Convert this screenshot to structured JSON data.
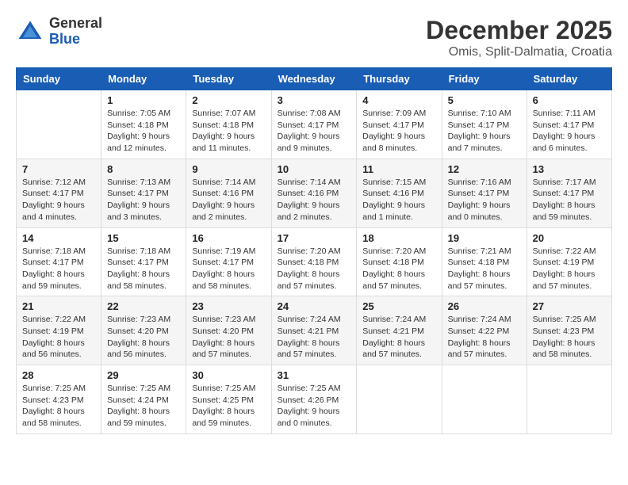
{
  "logo": {
    "general": "General",
    "blue": "Blue"
  },
  "header": {
    "month": "December 2025",
    "location": "Omis, Split-Dalmatia, Croatia"
  },
  "weekdays": [
    "Sunday",
    "Monday",
    "Tuesday",
    "Wednesday",
    "Thursday",
    "Friday",
    "Saturday"
  ],
  "weeks": [
    [
      {
        "day": "",
        "sunrise": "",
        "sunset": "",
        "daylight": ""
      },
      {
        "day": "1",
        "sunrise": "Sunrise: 7:05 AM",
        "sunset": "Sunset: 4:18 PM",
        "daylight": "Daylight: 9 hours and 12 minutes."
      },
      {
        "day": "2",
        "sunrise": "Sunrise: 7:07 AM",
        "sunset": "Sunset: 4:18 PM",
        "daylight": "Daylight: 9 hours and 11 minutes."
      },
      {
        "day": "3",
        "sunrise": "Sunrise: 7:08 AM",
        "sunset": "Sunset: 4:17 PM",
        "daylight": "Daylight: 9 hours and 9 minutes."
      },
      {
        "day": "4",
        "sunrise": "Sunrise: 7:09 AM",
        "sunset": "Sunset: 4:17 PM",
        "daylight": "Daylight: 9 hours and 8 minutes."
      },
      {
        "day": "5",
        "sunrise": "Sunrise: 7:10 AM",
        "sunset": "Sunset: 4:17 PM",
        "daylight": "Daylight: 9 hours and 7 minutes."
      },
      {
        "day": "6",
        "sunrise": "Sunrise: 7:11 AM",
        "sunset": "Sunset: 4:17 PM",
        "daylight": "Daylight: 9 hours and 6 minutes."
      }
    ],
    [
      {
        "day": "7",
        "sunrise": "Sunrise: 7:12 AM",
        "sunset": "Sunset: 4:17 PM",
        "daylight": "Daylight: 9 hours and 4 minutes."
      },
      {
        "day": "8",
        "sunrise": "Sunrise: 7:13 AM",
        "sunset": "Sunset: 4:17 PM",
        "daylight": "Daylight: 9 hours and 3 minutes."
      },
      {
        "day": "9",
        "sunrise": "Sunrise: 7:14 AM",
        "sunset": "Sunset: 4:16 PM",
        "daylight": "Daylight: 9 hours and 2 minutes."
      },
      {
        "day": "10",
        "sunrise": "Sunrise: 7:14 AM",
        "sunset": "Sunset: 4:16 PM",
        "daylight": "Daylight: 9 hours and 2 minutes."
      },
      {
        "day": "11",
        "sunrise": "Sunrise: 7:15 AM",
        "sunset": "Sunset: 4:16 PM",
        "daylight": "Daylight: 9 hours and 1 minute."
      },
      {
        "day": "12",
        "sunrise": "Sunrise: 7:16 AM",
        "sunset": "Sunset: 4:17 PM",
        "daylight": "Daylight: 9 hours and 0 minutes."
      },
      {
        "day": "13",
        "sunrise": "Sunrise: 7:17 AM",
        "sunset": "Sunset: 4:17 PM",
        "daylight": "Daylight: 8 hours and 59 minutes."
      }
    ],
    [
      {
        "day": "14",
        "sunrise": "Sunrise: 7:18 AM",
        "sunset": "Sunset: 4:17 PM",
        "daylight": "Daylight: 8 hours and 59 minutes."
      },
      {
        "day": "15",
        "sunrise": "Sunrise: 7:18 AM",
        "sunset": "Sunset: 4:17 PM",
        "daylight": "Daylight: 8 hours and 58 minutes."
      },
      {
        "day": "16",
        "sunrise": "Sunrise: 7:19 AM",
        "sunset": "Sunset: 4:17 PM",
        "daylight": "Daylight: 8 hours and 58 minutes."
      },
      {
        "day": "17",
        "sunrise": "Sunrise: 7:20 AM",
        "sunset": "Sunset: 4:18 PM",
        "daylight": "Daylight: 8 hours and 57 minutes."
      },
      {
        "day": "18",
        "sunrise": "Sunrise: 7:20 AM",
        "sunset": "Sunset: 4:18 PM",
        "daylight": "Daylight: 8 hours and 57 minutes."
      },
      {
        "day": "19",
        "sunrise": "Sunrise: 7:21 AM",
        "sunset": "Sunset: 4:18 PM",
        "daylight": "Daylight: 8 hours and 57 minutes."
      },
      {
        "day": "20",
        "sunrise": "Sunrise: 7:22 AM",
        "sunset": "Sunset: 4:19 PM",
        "daylight": "Daylight: 8 hours and 57 minutes."
      }
    ],
    [
      {
        "day": "21",
        "sunrise": "Sunrise: 7:22 AM",
        "sunset": "Sunset: 4:19 PM",
        "daylight": "Daylight: 8 hours and 56 minutes."
      },
      {
        "day": "22",
        "sunrise": "Sunrise: 7:23 AM",
        "sunset": "Sunset: 4:20 PM",
        "daylight": "Daylight: 8 hours and 56 minutes."
      },
      {
        "day": "23",
        "sunrise": "Sunrise: 7:23 AM",
        "sunset": "Sunset: 4:20 PM",
        "daylight": "Daylight: 8 hours and 57 minutes."
      },
      {
        "day": "24",
        "sunrise": "Sunrise: 7:24 AM",
        "sunset": "Sunset: 4:21 PM",
        "daylight": "Daylight: 8 hours and 57 minutes."
      },
      {
        "day": "25",
        "sunrise": "Sunrise: 7:24 AM",
        "sunset": "Sunset: 4:21 PM",
        "daylight": "Daylight: 8 hours and 57 minutes."
      },
      {
        "day": "26",
        "sunrise": "Sunrise: 7:24 AM",
        "sunset": "Sunset: 4:22 PM",
        "daylight": "Daylight: 8 hours and 57 minutes."
      },
      {
        "day": "27",
        "sunrise": "Sunrise: 7:25 AM",
        "sunset": "Sunset: 4:23 PM",
        "daylight": "Daylight: 8 hours and 58 minutes."
      }
    ],
    [
      {
        "day": "28",
        "sunrise": "Sunrise: 7:25 AM",
        "sunset": "Sunset: 4:23 PM",
        "daylight": "Daylight: 8 hours and 58 minutes."
      },
      {
        "day": "29",
        "sunrise": "Sunrise: 7:25 AM",
        "sunset": "Sunset: 4:24 PM",
        "daylight": "Daylight: 8 hours and 59 minutes."
      },
      {
        "day": "30",
        "sunrise": "Sunrise: 7:25 AM",
        "sunset": "Sunset: 4:25 PM",
        "daylight": "Daylight: 8 hours and 59 minutes."
      },
      {
        "day": "31",
        "sunrise": "Sunrise: 7:25 AM",
        "sunset": "Sunset: 4:26 PM",
        "daylight": "Daylight: 9 hours and 0 minutes."
      },
      {
        "day": "",
        "sunrise": "",
        "sunset": "",
        "daylight": ""
      },
      {
        "day": "",
        "sunrise": "",
        "sunset": "",
        "daylight": ""
      },
      {
        "day": "",
        "sunrise": "",
        "sunset": "",
        "daylight": ""
      }
    ]
  ]
}
